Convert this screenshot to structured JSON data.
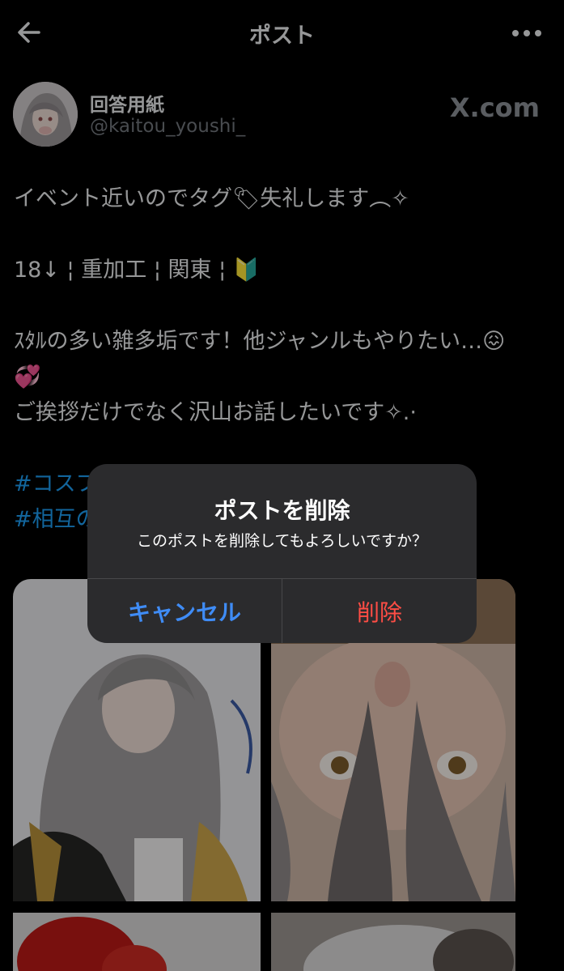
{
  "header": {
    "title": "ポスト"
  },
  "author": {
    "name": "回答用紙",
    "handle": "@kaitou_youshi_",
    "brand": "X.com"
  },
  "post": {
    "line1": "イベント近いのでタグ🏷失礼します︵✧",
    "line2": "18↓ ¦ 重加工 ¦ 関東 ¦ 🔰",
    "line3": "ｽﾀﾙの多い雑多垢です！他ジャンルもやりたい…😖",
    "line4": "💞",
    "line5": "ご挨拶だけでなく沢山お話したいです✧.·",
    "hashtag1": "#コスプ",
    "hashtag2": "#相互の"
  },
  "dialog": {
    "title": "ポストを削除",
    "message": "このポストを削除してもよろしいですか？",
    "cancel_label": "キャンセル",
    "delete_label": "削除"
  },
  "colors": {
    "link": "#1d9bf0",
    "cancel": "#3f8cf6",
    "destructive": "#ff4d45"
  }
}
